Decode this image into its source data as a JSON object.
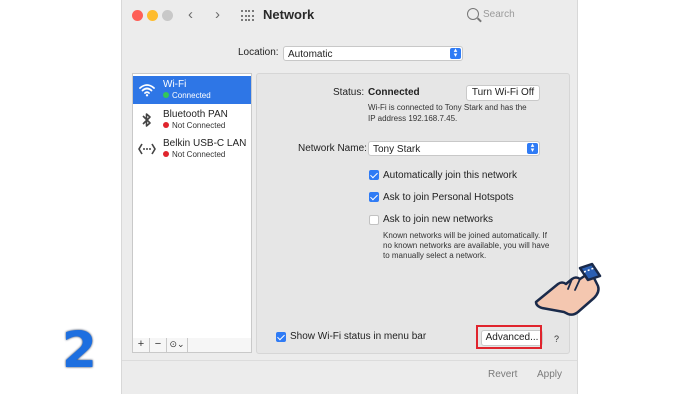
{
  "window": {
    "title": "Network",
    "search_placeholder": "Search"
  },
  "location": {
    "label": "Location:",
    "value": "Automatic"
  },
  "sidebar": {
    "items": [
      {
        "name": "Wi-Fi",
        "status": "Connected",
        "status_color": "#34c759",
        "icon": "wifi-icon"
      },
      {
        "name": "Bluetooth PAN",
        "status": "Not Connected",
        "status_color": "#e0242d",
        "icon": "bluetooth-icon"
      },
      {
        "name": "Belkin USB-C LAN",
        "status": "Not Connected",
        "status_color": "#e0242d",
        "icon": "ethernet-icon"
      }
    ],
    "add_label": "+",
    "remove_label": "−",
    "action_label": "⊙⌄"
  },
  "detail": {
    "status_label": "Status:",
    "status_value": "Connected",
    "turn_off_label": "Turn Wi-Fi Off",
    "status_desc_line1": "Wi-Fi is connected to Tony Stark and has the",
    "status_desc_line2": "IP address 192.168.7.45.",
    "network_name_label": "Network Name:",
    "network_name_value": "Tony Stark",
    "auto_join_label": "Automatically join this network",
    "auto_join_checked": true,
    "hotspots_label": "Ask to join Personal Hotspots",
    "hotspots_checked": true,
    "new_networks_label": "Ask to join new networks",
    "new_networks_checked": false,
    "known_desc_line1": "Known networks will be joined automatically. If",
    "known_desc_line2": "no known networks are available, you will have",
    "known_desc_line3": "to manually select a network.",
    "show_status_label": "Show Wi-Fi status in menu bar",
    "show_status_checked": true,
    "advanced_label": "Advanced...",
    "help_label": "?"
  },
  "footer": {
    "revert_label": "Revert",
    "apply_label": "Apply"
  },
  "overlay": {
    "step_number": "2",
    "accent_color": "#1d6fe0",
    "highlight_color": "#e0242d"
  }
}
